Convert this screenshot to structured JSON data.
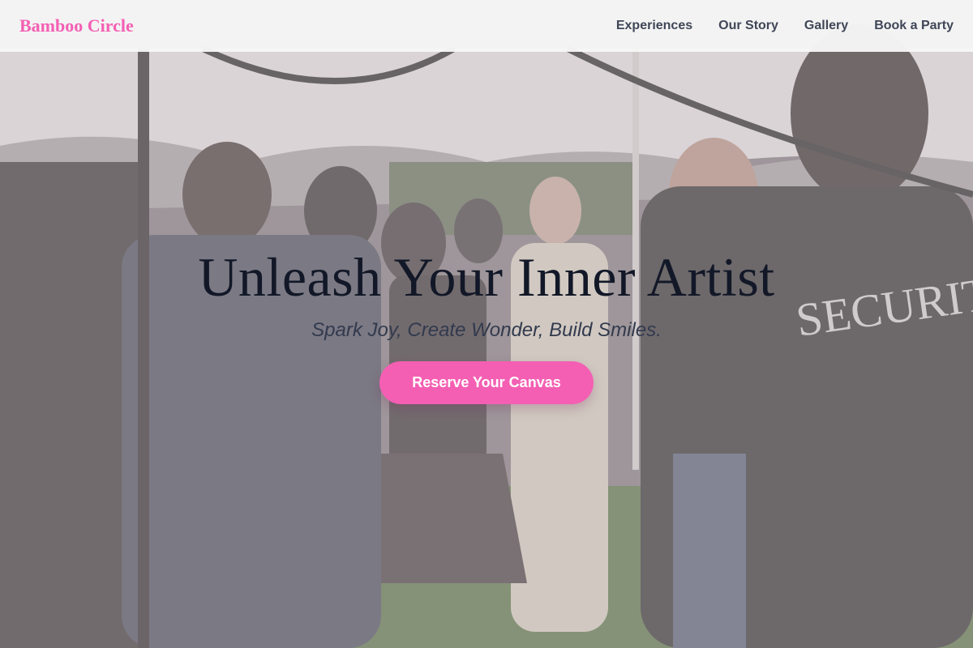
{
  "brand": {
    "name": "Bamboo Circle"
  },
  "nav": {
    "items": [
      {
        "label": "Experiences"
      },
      {
        "label": "Our Story"
      },
      {
        "label": "Gallery"
      },
      {
        "label": "Book a Party"
      }
    ]
  },
  "hero": {
    "title": "Unleash Your Inner Artist",
    "subtitle": "Spark Joy, Create Wonder, Build Smiles.",
    "cta_label": "Reserve Your Canvas",
    "background_image": "outdoor-crowd-under-white-tents-photo",
    "security_vest_text": "SECURITY"
  },
  "colors": {
    "accent": "#f45fb3",
    "nav_text": "#3f4657",
    "title_text": "#121827",
    "subtitle_text": "#323a4e",
    "nav_bg": "#f7f7f7"
  }
}
